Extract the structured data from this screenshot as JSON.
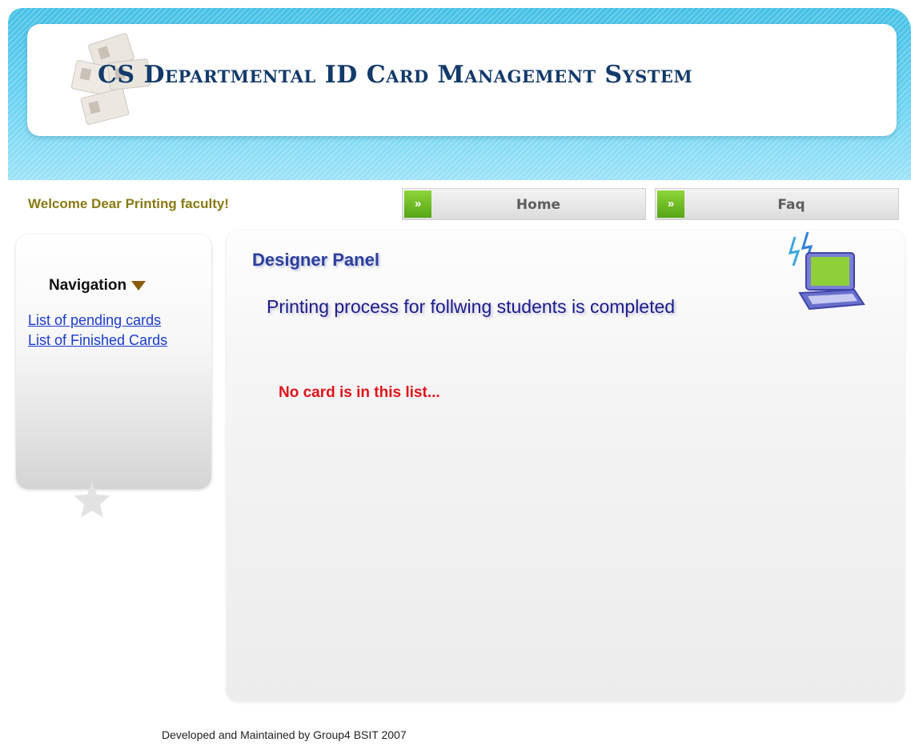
{
  "header": {
    "title": "CS Departmental ID Card Management System",
    "logo_icon": "id-cards-collage-icon"
  },
  "topbar": {
    "welcome_text": "Welcome Dear Printing faculty!",
    "nav_buttons": [
      {
        "label": "Home",
        "icon": "double-chevron-right-icon"
      },
      {
        "label": "Faq",
        "icon": "double-chevron-right-icon"
      }
    ]
  },
  "sidebar": {
    "heading": "Navigation",
    "links": [
      {
        "label": "List of pending cards"
      },
      {
        "label": "List of Finished Cards"
      }
    ]
  },
  "main": {
    "panel_title": "Designer Panel",
    "status_message": "Printing process for follwing students is completed",
    "empty_message": "No card is in this list...",
    "decor_icon": "laptop-icon"
  },
  "footer": {
    "text": "Developed and Maintained by Group4 BSIT 2007"
  },
  "colors": {
    "header_blue": "#43c0e6",
    "welcome_text": "#8a7a12",
    "link_blue": "#1a3ccc",
    "panel_title": "#2c3f9c",
    "error_red": "#e0141a",
    "button_green": "#55a516"
  }
}
